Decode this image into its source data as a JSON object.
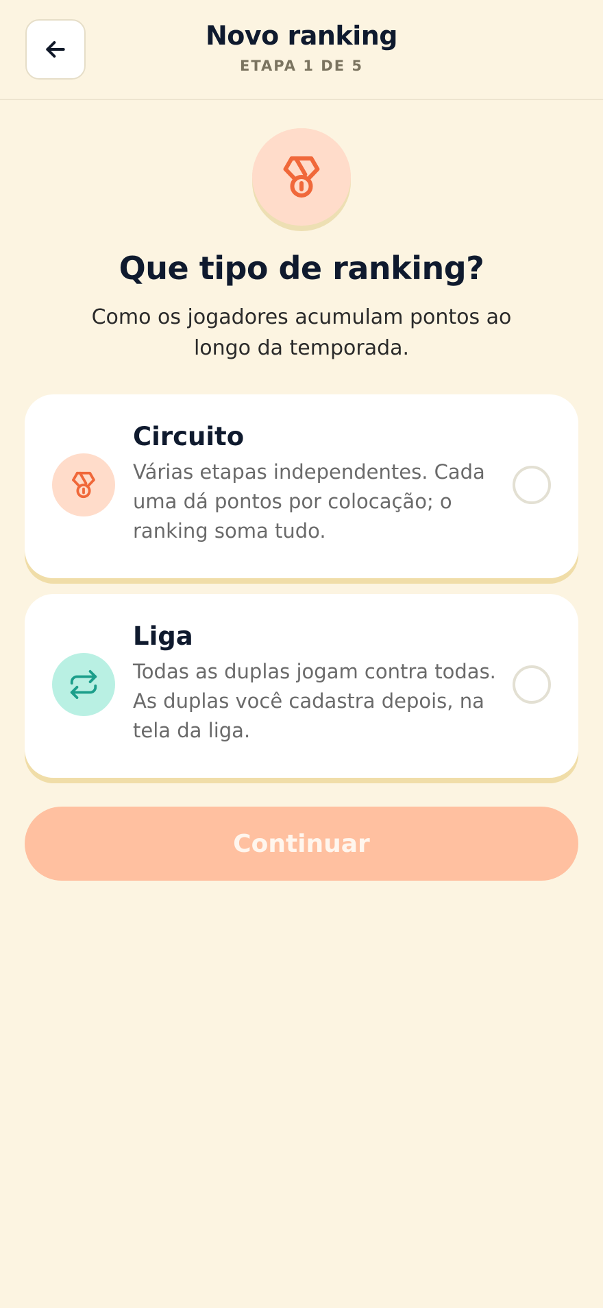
{
  "header": {
    "title": "Novo ranking",
    "step": "ETAPA 1 DE 5",
    "back_icon": "arrow-left-icon"
  },
  "hero": {
    "icon": "medal-icon",
    "title": "Que tipo de ranking?",
    "subtitle": "Como os jogadores acumulam pontos ao longo da temporada."
  },
  "options": [
    {
      "title": "Circuito",
      "description": "Várias etapas independentes. Cada uma dá pontos por colocação; o ranking soma tudo.",
      "icon": "medal-icon",
      "selected": false
    },
    {
      "title": "Liga",
      "description": "Todas as duplas jogam contra todas. As duplas você cadastra depois, na tela da liga.",
      "icon": "repeat-arrows-icon",
      "selected": false
    }
  ],
  "continue_button": {
    "label": "Continuar",
    "enabled": false
  },
  "colors": {
    "background": "#FCF4E1",
    "accent": "#F0683A",
    "accent_light": "#FFDCCA",
    "teal": "#1B9E8A",
    "teal_light": "#B9F0E3",
    "button_disabled": "#FFC0A0"
  }
}
